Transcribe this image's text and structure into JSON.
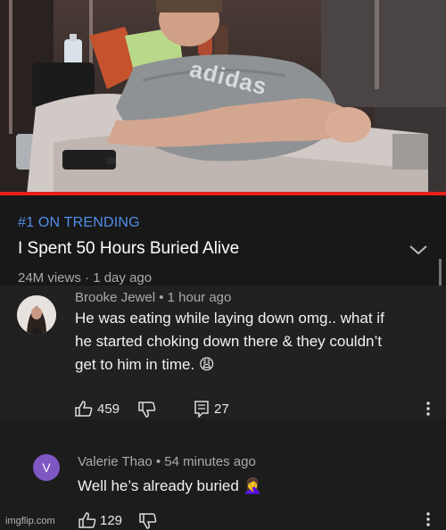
{
  "video": {
    "thumbnail_icon": "video-thumbnail-image",
    "shirt_brand": "adidas",
    "progress": 1.0,
    "progress_color": "#e62117"
  },
  "info": {
    "trending": "#1 ON TRENDING",
    "title": "I Spent 50 Hours Buried Alive",
    "views": "24M views",
    "age": "1 day ago",
    "expand_icon": "chevron-down-icon"
  },
  "comments": [
    {
      "author": "Brooke Jewel",
      "time": "1 hour ago",
      "lines": [
        "He was eating while laying down omg.. what if",
        "he started choking down there & they couldn’t",
        "get to him in time. 😩"
      ],
      "likes": "459",
      "replies": "27"
    },
    {
      "author": "Valerie Thao",
      "avatar_letter": "V",
      "avatar_color": "#7e57c2",
      "time": "54 minutes ago",
      "text": "Well he’s already buried 🤦‍♀️",
      "likes": "129"
    }
  ],
  "watermark": "imgflip.com"
}
